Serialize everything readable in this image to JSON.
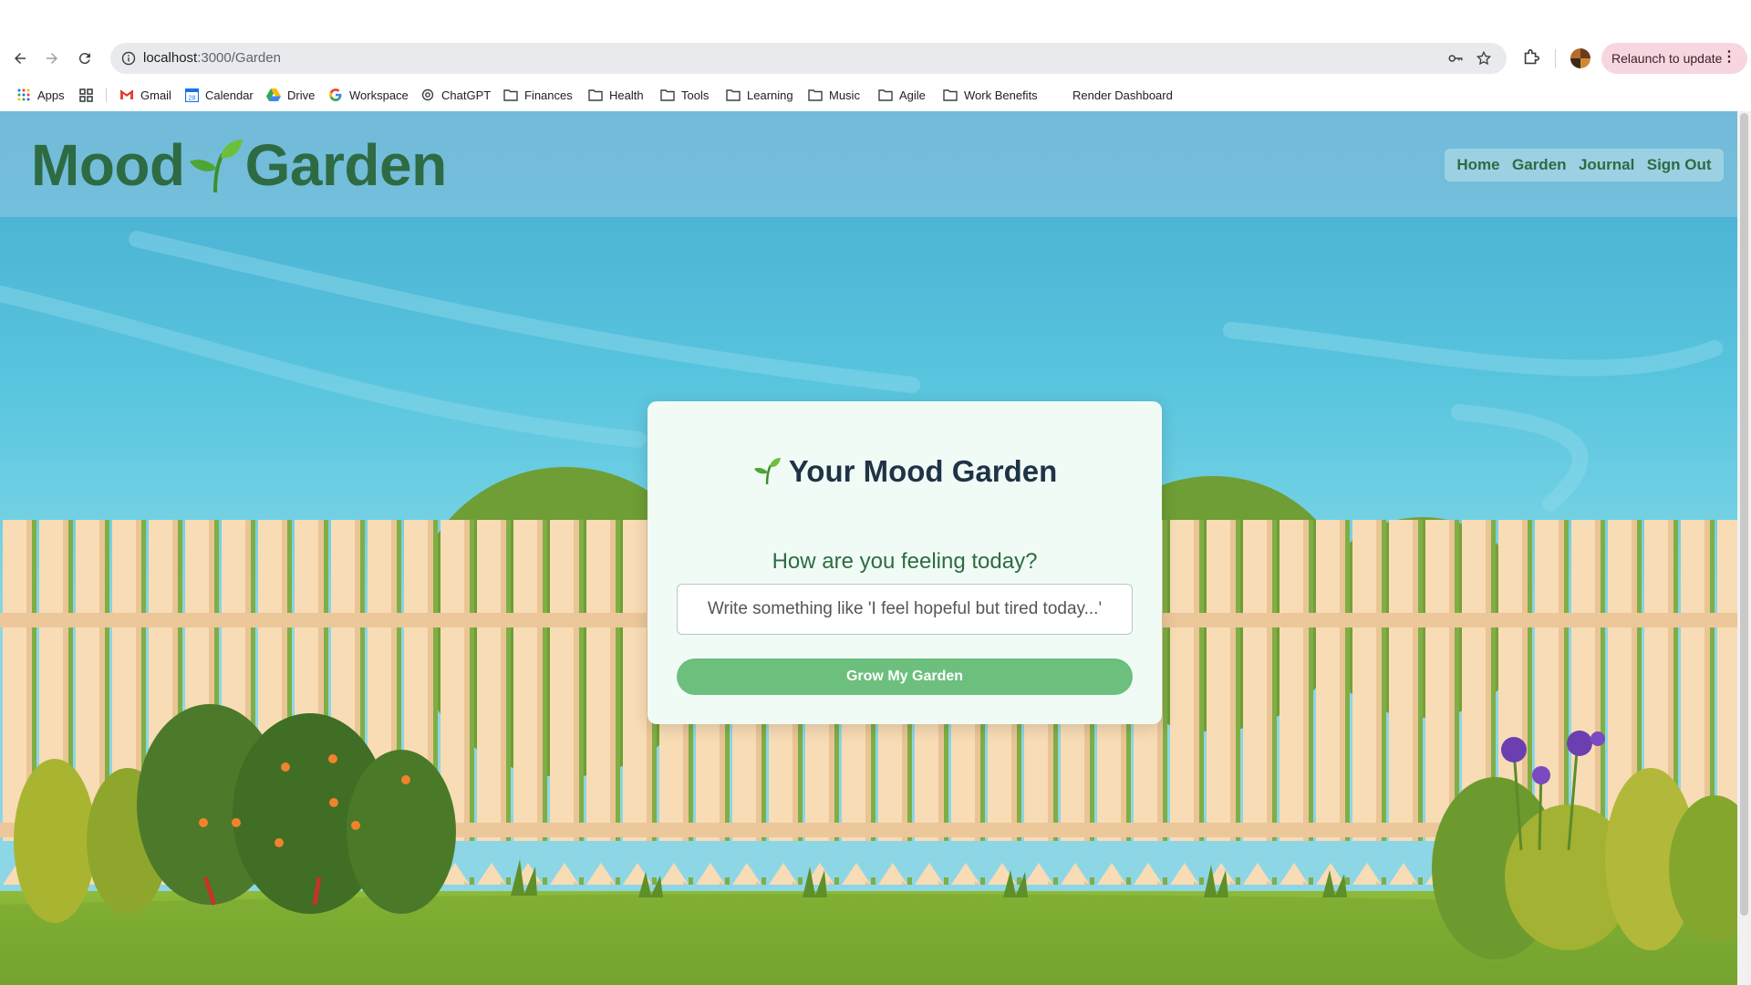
{
  "browser": {
    "url_host": "localhost",
    "url_path": ":3000/Garden",
    "relaunch_label": "Relaunch to update",
    "relaunch_dots": "⋮",
    "bookmarks": [
      {
        "label": "Apps",
        "icon": "apps-grid-icon"
      },
      {
        "label": "Gmail",
        "icon": "gmail-icon"
      },
      {
        "label": "Calendar",
        "icon": "calendar-icon"
      },
      {
        "label": "Drive",
        "icon": "drive-icon"
      },
      {
        "label": "Workspace",
        "icon": "google-icon"
      },
      {
        "label": "ChatGPT",
        "icon": "chatgpt-icon"
      },
      {
        "label": "Finances",
        "icon": "folder-icon"
      },
      {
        "label": "Health",
        "icon": "folder-icon"
      },
      {
        "label": "Tools",
        "icon": "folder-icon"
      },
      {
        "label": "Learning",
        "icon": "folder-icon"
      },
      {
        "label": "Music",
        "icon": "folder-icon"
      },
      {
        "label": "Agile",
        "icon": "folder-icon"
      },
      {
        "label": "Work Benefits",
        "icon": "folder-icon"
      },
      {
        "label": "Render Dashboard",
        "icon": ""
      }
    ]
  },
  "site": {
    "logo_left": "Mood",
    "logo_right": "Garden",
    "nav": [
      "Home",
      "Garden",
      "Journal",
      "Sign Out"
    ]
  },
  "card": {
    "title": "Your Mood Garden",
    "question": "How are you feeling today?",
    "input_placeholder": "Write something like 'I feel hopeful but tired today...'",
    "button_label": "Grow My Garden"
  },
  "colors": {
    "brand_green": "#2e6b43",
    "button_green": "#6cbf7d",
    "relaunch_pink": "#f8d6e0"
  }
}
